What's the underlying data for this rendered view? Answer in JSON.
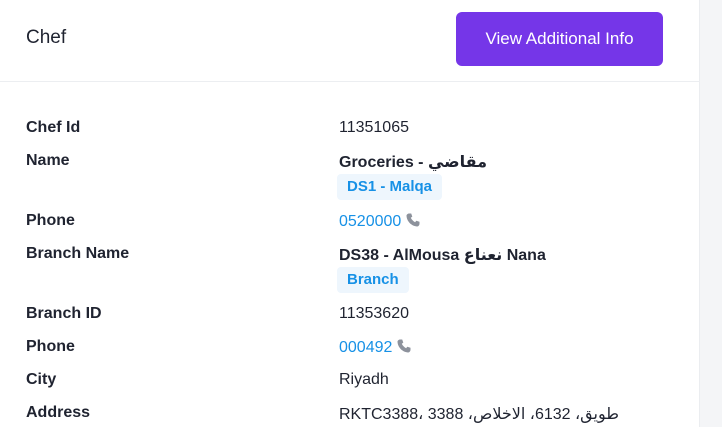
{
  "header": {
    "title": "Chef",
    "view_button_label": "View Additional Info"
  },
  "details": {
    "chef_id_label": "Chef Id",
    "chef_id_value": "11351065",
    "name_label": "Name",
    "name_value": "Groceries - مقاضي",
    "name_tag": "DS1 - Malqa",
    "phone_label": "Phone",
    "phone_value": "0520000",
    "branch_name_label": "Branch Name",
    "branch_name_value": "DS38 - AlMousa نعناع Nana",
    "branch_tag": "Branch",
    "branch_id_label": "Branch ID",
    "branch_id_value": "11353620",
    "branch_phone_label": "Phone",
    "branch_phone_value": "000492",
    "city_label": "City",
    "city_value": "Riyadh",
    "address_label": "Address",
    "address_value": "RKTC3388، 3388 ،طويق، 6132، الاخلاص"
  },
  "icons": {
    "phone": "phone-icon"
  },
  "colors": {
    "accent": "#7536e8",
    "link": "#1791e6",
    "tag_bg": "#eef6fd",
    "text": "#1f2330",
    "icon": "#8d929c"
  }
}
